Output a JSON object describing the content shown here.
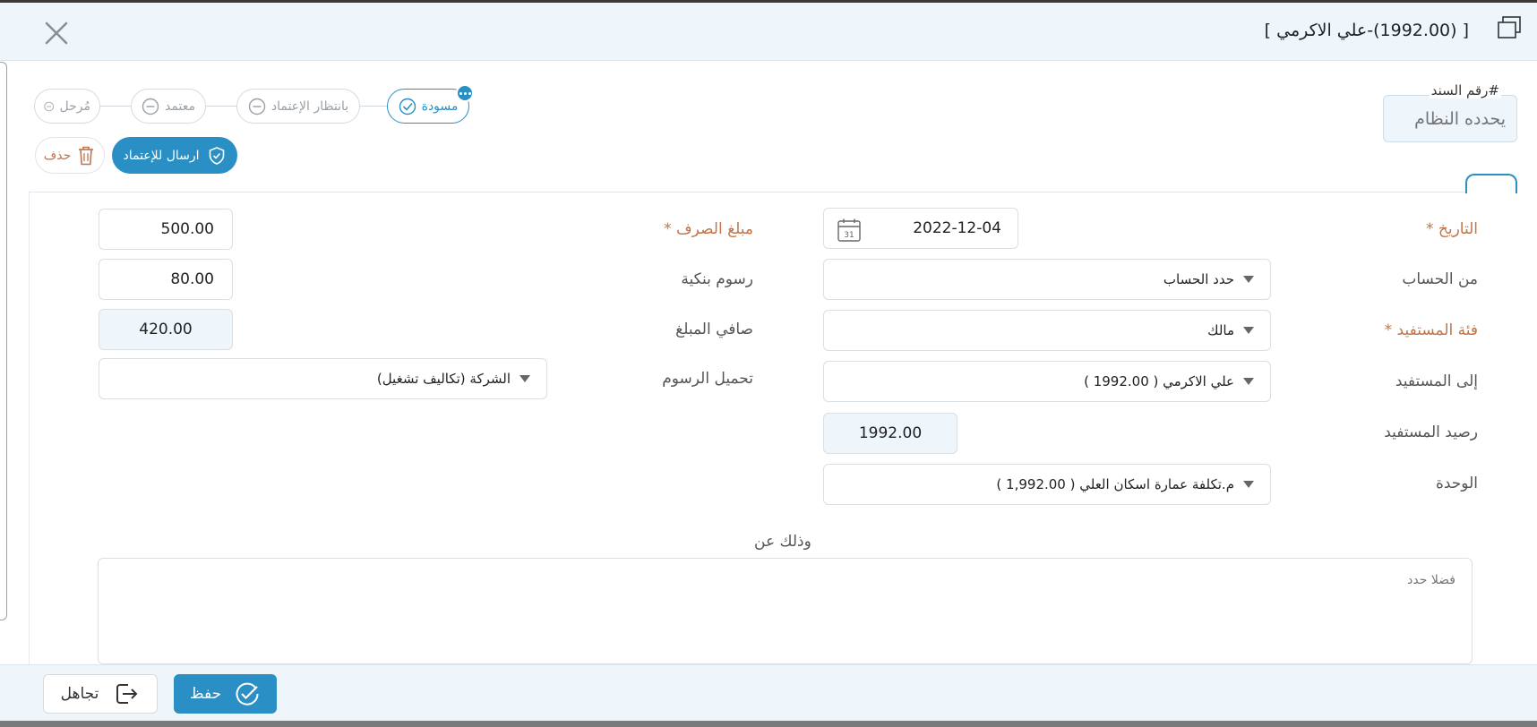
{
  "header": {
    "title": "[ (1992.00)-علي الاكرمي ]"
  },
  "doc": {
    "label": "#رقم السند",
    "placeholder": "يحدده النظام"
  },
  "steps": [
    {
      "label": "مسودة"
    },
    {
      "label": "بانتظار الإعتماد"
    },
    {
      "label": "معتمد"
    },
    {
      "label": "مُرحل"
    }
  ],
  "actions": {
    "submit_label": "ارسال للإعتماد",
    "delete_label": "حذف"
  },
  "form": {
    "date": {
      "label": "التاريخ *",
      "value": "2022-12-04"
    },
    "from_account": {
      "label": "من الحساب",
      "value": "حدد الحساب"
    },
    "beneficiary_category": {
      "label": "فئة المستفيد *",
      "value": "مالك"
    },
    "to_beneficiary": {
      "label": "إلى المستفيد",
      "value": "علي الاكرمي ( 1992.00 )"
    },
    "beneficiary_balance": {
      "label": "رصيد المستفيد",
      "value": "1992.00"
    },
    "unit": {
      "label": "الوحدة",
      "value": "م.تكلفة عمارة اسكان العلي ( 1,992.00 )"
    },
    "amount": {
      "label": "مبلغ الصرف *",
      "value": "500.00"
    },
    "bank_fees": {
      "label": "رسوم بنكية",
      "value": "80.00"
    },
    "net_amount": {
      "label": "صافي المبلغ",
      "value": "420.00"
    },
    "fees_bearer": {
      "label": "تحميل الرسوم",
      "value": "الشركة (تكاليف تشغيل)"
    }
  },
  "note": {
    "label": "وذلك عن",
    "placeholder": "فضلا حدد"
  },
  "footer": {
    "save_label": "حفظ",
    "ignore_label": "تجاهل"
  },
  "colors": {
    "accent": "#2a8fc4",
    "required": "#c0754a"
  }
}
